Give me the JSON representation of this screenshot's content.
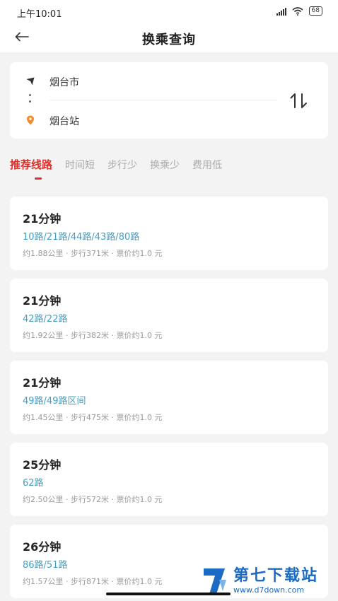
{
  "status_bar": {
    "time": "上午10:01",
    "battery": "68"
  },
  "header": {
    "title": "换乘查询"
  },
  "route": {
    "origin": "烟台市",
    "destination": "烟台站"
  },
  "tabs": [
    {
      "label": "推荐线路",
      "active": true
    },
    {
      "label": "时间短",
      "active": false
    },
    {
      "label": "步行少",
      "active": false
    },
    {
      "label": "换乘少",
      "active": false
    },
    {
      "label": "费用低",
      "active": false
    }
  ],
  "results": [
    {
      "duration": "21分钟",
      "lines": "10路/21路/44路/43路/80路",
      "meta": "约1.88公里 · 步行371米 · 票价约1.0  元"
    },
    {
      "duration": "21分钟",
      "lines": "42路/22路",
      "meta": "约1.92公里 · 步行382米 · 票价约1.0  元"
    },
    {
      "duration": "21分钟",
      "lines": "49路/49路区间",
      "meta": "约1.45公里 · 步行475米 · 票价约1.0  元"
    },
    {
      "duration": "25分钟",
      "lines": "62路",
      "meta": "约2.50公里 · 步行572米 · 票价约1.0  元"
    },
    {
      "duration": "26分钟",
      "lines": "86路/51路",
      "meta": "约1.57公里 · 步行871米 · 票价约1.0  元"
    }
  ],
  "watermark": {
    "title": "第七下载站",
    "url": "www.d7down.com"
  },
  "colors": {
    "accent": "#e0302b",
    "link": "#3fa0c6",
    "watermark": "#1b6ac4"
  }
}
